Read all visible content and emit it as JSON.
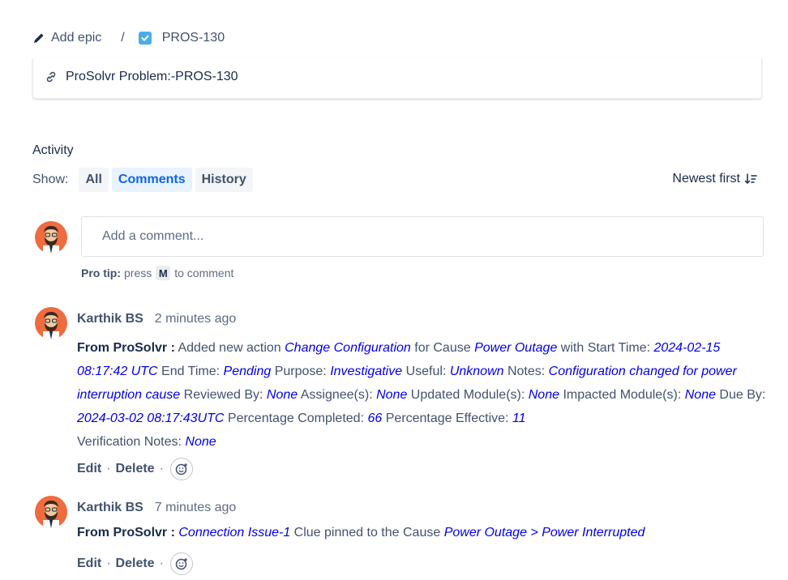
{
  "breadcrumb": {
    "epic_label": "Add epic",
    "separator": "/",
    "issue_key": "PROS-130"
  },
  "linked_item": {
    "text": "ProSolvr Problem:-PROS-130"
  },
  "activity": {
    "title": "Activity",
    "show_label": "Show:",
    "filters": [
      "All",
      "Comments",
      "History"
    ],
    "active_filter": "Comments",
    "sort_label": "Newest first"
  },
  "comment_box": {
    "placeholder": "Add a comment...",
    "protip_bold": "Pro tip:",
    "protip_pre": "press",
    "protip_key": "M",
    "protip_post": "to comment"
  },
  "comments": [
    {
      "author": "Karthik BS",
      "time": "2 minutes ago",
      "prefix": "From ProSolvr :",
      "t1": " Added new action ",
      "v1": "Change Configuration",
      "t2": "  for Cause ",
      "v2": "Power Outage",
      "t3": "  with Start Time: ",
      "v3": "2024-02-15 08:17:42 UTC",
      "t4": "  End Time: ",
      "v4": "Pending",
      "t5": "  Purpose: ",
      "v5": "Investigative",
      "t6": "  Useful: ",
      "v6": "Unknown",
      "t7": "  Notes: ",
      "v7": "Configuration changed for power interruption cause",
      "t8": "  Reviewed By: ",
      "v8": "None",
      "t9": "  Assignee(s): ",
      "v9": "None",
      "t10": "  Updated Module(s): ",
      "v10": "None",
      "t11": "  Impacted Module(s): ",
      "v11": "None",
      "t12": "  Due By: ",
      "v12": "2024-03-02 08:17:43UTC",
      "t13": "  Percentage Completed: ",
      "v13": "66",
      "t14": "  Percentage Effective: ",
      "v14": "11",
      "t15": " Verification Notes: ",
      "v15": "None",
      "edit": "Edit",
      "delete": "Delete",
      "dot": "·"
    },
    {
      "author": "Karthik BS",
      "time": "7 minutes ago",
      "prefix": "From ProSolvr :",
      "t1": " ",
      "v1": "Connection Issue-1",
      "t2": "  Clue pinned to the Cause ",
      "v2": "Power Outage > Power Interrupted",
      "edit": "Edit",
      "delete": "Delete",
      "dot": "·"
    }
  ],
  "colors": {
    "link": "#0000ee",
    "active_filter_bg": "#e9f2ff",
    "active_filter_text": "#0c66e4",
    "avatar_bg": "#f06b3e",
    "checkbox": "#4bade8"
  },
  "icons": [
    "pencil-icon",
    "checkbox-icon",
    "link-icon",
    "sort-icon",
    "avatar",
    "emoji-reaction-icon"
  ]
}
